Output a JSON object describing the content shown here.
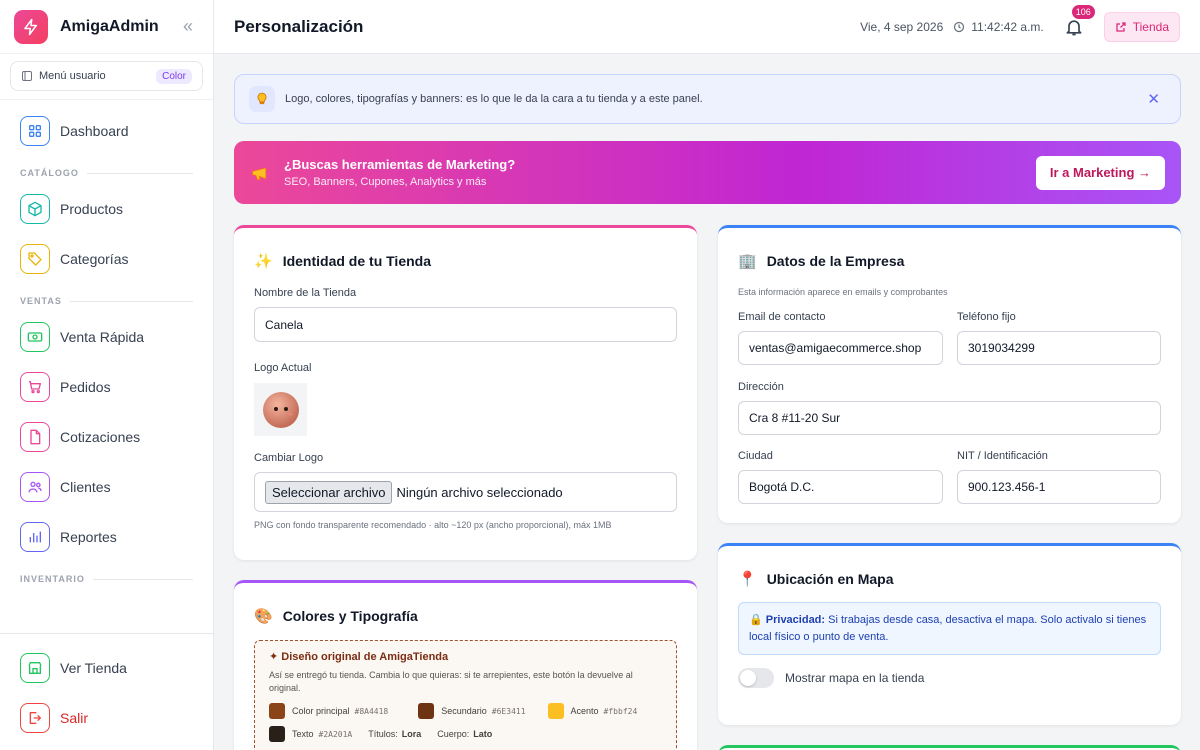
{
  "app": {
    "name": "AmigaAdmin"
  },
  "user_menu": {
    "label": "Menú usuario",
    "badge": "Color"
  },
  "sidebar": {
    "dashboard": "Dashboard",
    "sections": {
      "catalog": "CATÁLOGO",
      "sales": "VENTAS",
      "inventory": "INVENTARIO"
    },
    "items": {
      "products": "Productos",
      "categories": "Categorías",
      "quick_sale": "Venta Rápida",
      "orders": "Pedidos",
      "quotes": "Cotizaciones",
      "clients": "Clientes",
      "reports": "Reportes"
    },
    "bottom": {
      "view_store": "Ver Tienda",
      "logout": "Salir"
    }
  },
  "header": {
    "title": "Personalización",
    "date": "Vie, 4 sep 2026",
    "time": "11:42:42 a.m.",
    "notifications": "106",
    "store_button": "Tienda"
  },
  "info_banner": {
    "text": "Logo, colores, tipografías y banners: es lo que le da la cara a tu tienda y a este panel."
  },
  "promo": {
    "title": "¿Buscas herramientas de Marketing?",
    "subtitle": "SEO, Banners, Cupones, Analytics y más",
    "button": "Ir a Marketing →"
  },
  "identity": {
    "title": "Identidad de tu Tienda",
    "store_name_label": "Nombre de la Tienda",
    "store_name_value": "Canela",
    "logo_label": "Logo Actual",
    "change_logo_label": "Cambiar Logo",
    "file_button": "Seleccionar archivo",
    "file_status": "Ningún archivo seleccionado",
    "hint": "PNG con fondo transparente recomendado · alto ~120 px (ancho proporcional), máx 1MB"
  },
  "company": {
    "title": "Datos de la Empresa",
    "subtitle": "Esta información aparece en emails y comprobantes",
    "email_label": "Email de contacto",
    "email_value": "ventas@amigaecommerce.shop",
    "phone_label": "Teléfono fijo",
    "phone_value": "3019034299",
    "address_label": "Dirección",
    "address_value": "Cra 8 #11-20 Sur",
    "city_label": "Ciudad",
    "city_value": "Bogotá D.C.",
    "nit_label": "NIT / Identificación",
    "nit_value": "900.123.456-1"
  },
  "map": {
    "title": "Ubicación en Mapa",
    "privacy_bold": "Privacidad:",
    "privacy_text": " Si trabajas desde casa, desactiva el mapa. Solo activalo si tienes local físico o punto de venta.",
    "toggle_label": "Mostrar mapa en la tienda"
  },
  "colors": {
    "title": "Colores y Tipografía",
    "original_title": "✦ Diseño original de AmigaTienda",
    "original_text": "Así se entregó tu tienda. Cambia lo que quieras: si te arrepientes, este botón la devuelve al original.",
    "swatches": [
      {
        "label": "Color principal",
        "hex": "#8A4418"
      },
      {
        "label": "Secundario",
        "hex": "#6E3411"
      },
      {
        "label": "Acento",
        "hex": "#fbbf24"
      },
      {
        "label": "Texto",
        "hex": "#2A201A"
      }
    ],
    "titles_label": "Títulos:",
    "titles_font": "Lora",
    "body_label": "Cuerpo:",
    "body_font": "Lato"
  },
  "accent_colors": {
    "pink": "#ec4899",
    "purple": "#a855f7",
    "blue": "#3b82f6",
    "green": "#22c55e"
  }
}
